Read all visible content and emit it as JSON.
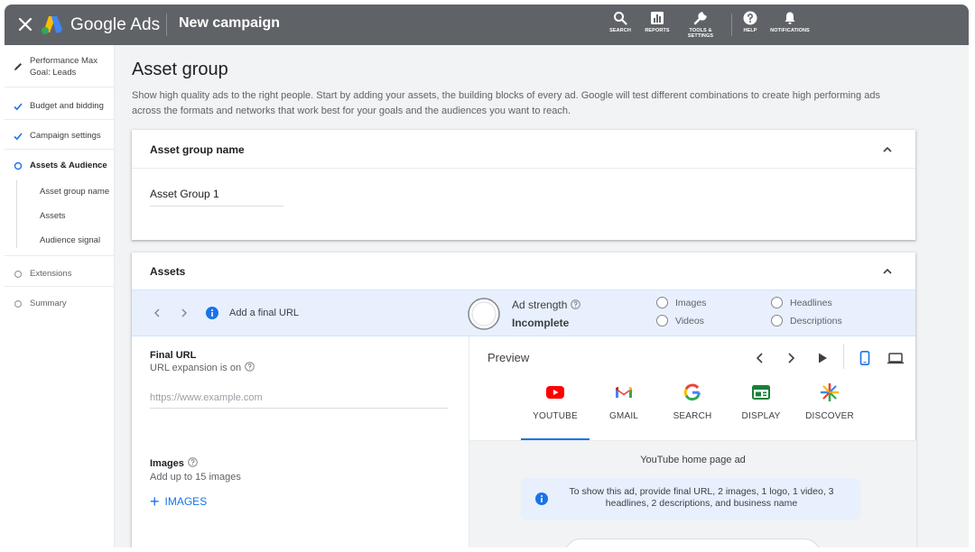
{
  "app": {
    "brand": "Google Ads",
    "page_name": "New campaign"
  },
  "toolbar": {
    "search": "SEARCH",
    "reports": "REPORTS",
    "tools_line1": "TOOLS &",
    "tools_line2": "SETTINGS",
    "help": "HELP",
    "notifications": "NOTIFICATIONS"
  },
  "sidebar": {
    "campaign_type_line1": "Performance Max",
    "campaign_type_line2": "Goal: Leads",
    "budget": "Budget and bidding",
    "settings": "Campaign settings",
    "assets_audience": "Assets & Audience",
    "sub_asset_group_name": "Asset group name",
    "sub_assets": "Assets",
    "sub_audience_signal": "Audience signal",
    "extensions": "Extensions",
    "summary": "Summary"
  },
  "main": {
    "title": "Asset group",
    "description": "Show high quality ads to the right people. Start by adding your assets, the building blocks of every ad. Google will test different combinations to create high performing ads across the formats and networks that work best for your goals and the audiences you want to reach."
  },
  "asset_group_card": {
    "title": "Asset group name",
    "value": "Asset Group 1"
  },
  "assets_card": {
    "title": "Assets",
    "hint": "Add a final URL",
    "ad_strength_label": "Ad strength",
    "ad_strength_value": "Incomplete",
    "checklist": {
      "images": "Images",
      "videos": "Videos",
      "headlines": "Headlines",
      "descriptions": "Descriptions"
    },
    "final_url": {
      "label": "Final URL",
      "sub": "URL expansion is on",
      "placeholder": "https://www.example.com"
    },
    "images": {
      "label": "Images",
      "sub": "Add up to 15 images",
      "add_button": "IMAGES"
    }
  },
  "preview": {
    "title": "Preview",
    "channels": {
      "youtube": "YOUTUBE",
      "gmail": "GMAIL",
      "search": "SEARCH",
      "display": "DISPLAY",
      "discover": "DISCOVER"
    },
    "selected_channel": "YOUTUBE",
    "ad_type": "YouTube home page ad",
    "notice": "To show this ad, provide final URL, 2 images, 1 logo, 1 video, 3 headlines, 2 descriptions, and business name"
  },
  "icons": {
    "close": "close-icon",
    "logo": "google-ads-logo",
    "search": "search-icon",
    "reports": "reports-icon",
    "tools": "wrench-icon",
    "help": "help-icon",
    "notifications": "bell-icon",
    "edit": "pencil-icon",
    "check": "check-icon",
    "current": "circle-icon",
    "collapse": "chevron-up-icon",
    "info": "info-icon",
    "mobile": "phone-icon",
    "desktop": "laptop-icon",
    "play": "play-icon"
  },
  "colors": {
    "topbar": "#5f6368",
    "accent": "#1a73e8",
    "strip": "#e8f0fe",
    "youtube": "#ff0000",
    "display": "#188038"
  }
}
